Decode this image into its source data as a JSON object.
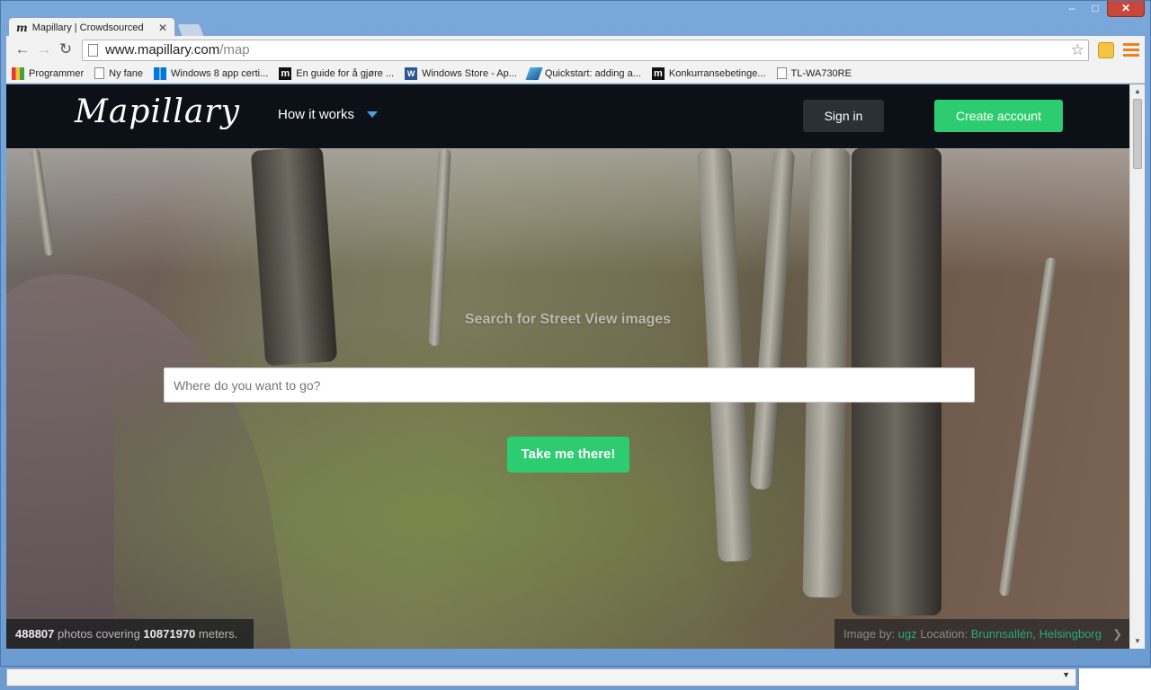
{
  "browser": {
    "tab_title": "Mapillary | Crowdsourced",
    "url_domain": "www.mapillary.com",
    "url_path": "/map",
    "bookmarks": [
      {
        "icon": "apps-grid-icon",
        "label": "Programmer"
      },
      {
        "icon": "page-icon",
        "label": "Ny fane"
      },
      {
        "icon": "windows-icon",
        "label": "Windows 8 app certi..."
      },
      {
        "icon": "m-icon",
        "label": "En guide for å gjøre ..."
      },
      {
        "icon": "word-icon",
        "label": "Windows Store - Ap..."
      },
      {
        "icon": "azure-icon",
        "label": "Quickstart: adding a..."
      },
      {
        "icon": "m-icon",
        "label": "Konkurransebetinge..."
      },
      {
        "icon": "page-icon",
        "label": "TL-WA730RE"
      }
    ]
  },
  "header": {
    "logo": "Mapillary",
    "nav_label": "How it works",
    "signin_label": "Sign in",
    "create_label": "Create account"
  },
  "hero": {
    "heading": "Search for Street View images",
    "search_placeholder": "Where do you want to go?",
    "button_label": "Take me there!"
  },
  "stats": {
    "photos": "488807",
    "photos_text": "photos covering",
    "meters": "10871970",
    "meters_text": "meters."
  },
  "credit": {
    "image_by_label": "Image by:",
    "user": "ugz",
    "location_label": "Location:",
    "location": "Brunnsallén, Helsingborg"
  },
  "colors": {
    "accent_green": "#2ecc71",
    "header_bg": "#0c1118",
    "link_teal": "#2aa87f"
  }
}
